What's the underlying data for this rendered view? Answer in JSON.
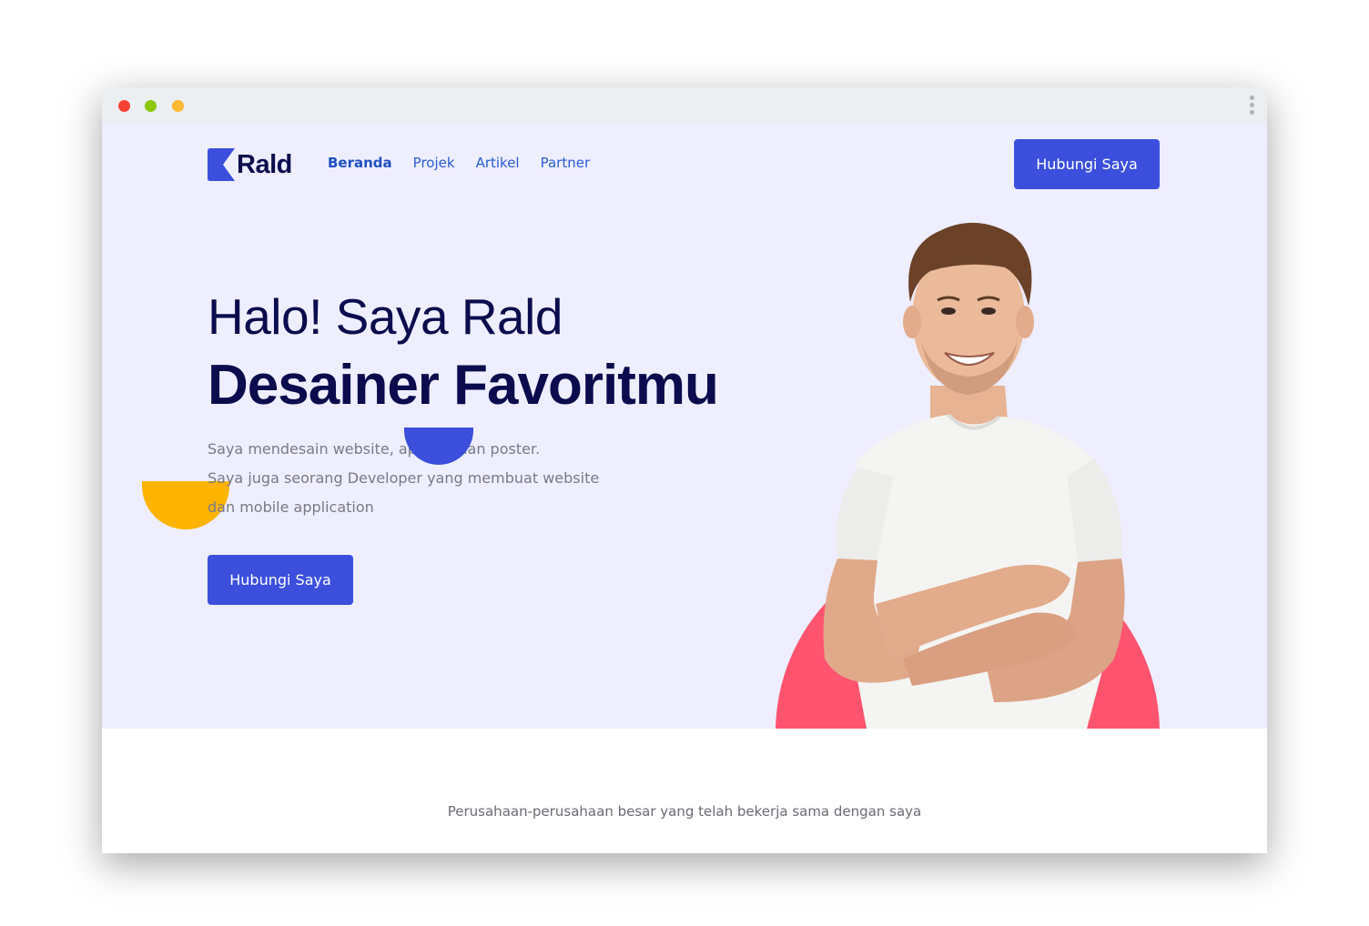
{
  "window": {
    "controls": [
      "close",
      "minimize",
      "maximize"
    ],
    "menu_icon": "vertical-dots-icon"
  },
  "brand": {
    "name": "Rald",
    "mark_icon": "chevron-k-logo-icon",
    "color": "#3b4fdc"
  },
  "nav": {
    "items": [
      {
        "label": "Beranda",
        "active": true
      },
      {
        "label": "Projek",
        "active": false
      },
      {
        "label": "Artikel",
        "active": false
      },
      {
        "label": "Partner",
        "active": false
      }
    ]
  },
  "header": {
    "cta_label": "Hubungi Saya"
  },
  "hero": {
    "greeting": "Halo! Saya Rald",
    "headline": "Desainer Favoritmu",
    "description_lines": [
      "Saya mendesain website, aplikasi dan poster.",
      "Saya juga seorang Developer yang membuat website",
      "dan mobile application"
    ],
    "cta_label": "Hubungi Saya",
    "image": "smiling-man-white-tshirt-arms-crossed"
  },
  "partners": {
    "heading": "Perusahaan-perusahaan besar yang telah bekerja sama dengan saya"
  },
  "colors": {
    "accent": "#3b4fdc",
    "hero_bg": "#eeeefe",
    "heading": "#0b0b4e",
    "pink": "#fe5470",
    "yellow": "#fcb400"
  }
}
